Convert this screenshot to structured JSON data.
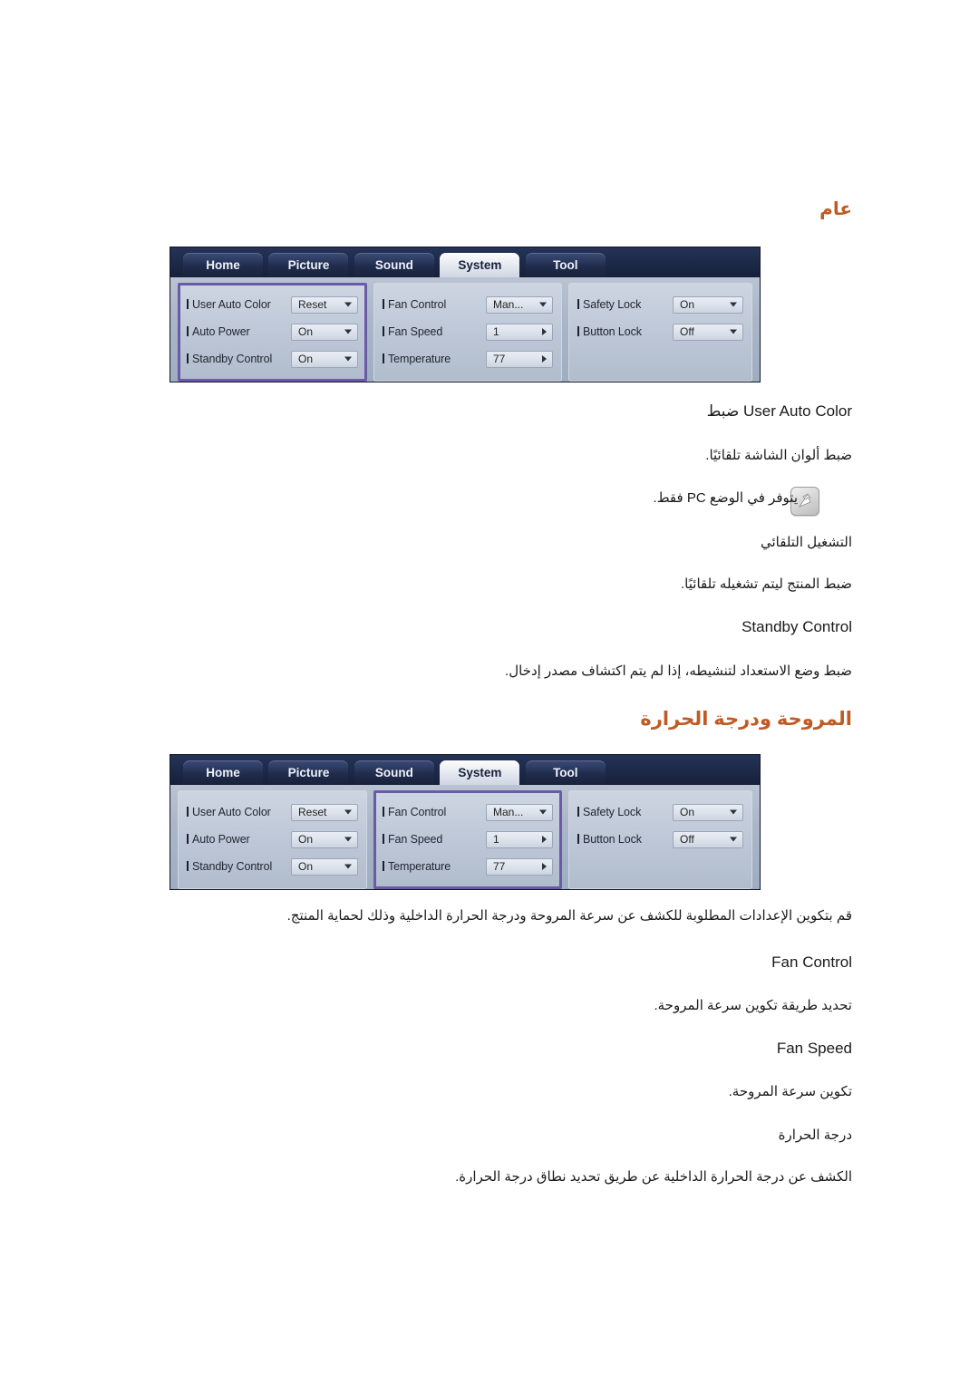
{
  "headings": {
    "general": "عام",
    "fan_temperature": "المروحة ودرجة الحرارة"
  },
  "osd": {
    "tabs": [
      {
        "label": "Home",
        "active": false
      },
      {
        "label": "Picture",
        "active": false
      },
      {
        "label": "Sound",
        "active": false
      },
      {
        "label": "System",
        "active": true
      },
      {
        "label": "Tool",
        "active": false
      }
    ],
    "groups": [
      {
        "name": "general-group",
        "rows": [
          {
            "label": "User Auto Color",
            "value": "Reset",
            "arrow": "down"
          },
          {
            "label": "Auto Power",
            "value": "On",
            "arrow": "down"
          },
          {
            "label": "Standby Control",
            "value": "On",
            "arrow": "down"
          }
        ]
      },
      {
        "name": "fan-group",
        "rows": [
          {
            "label": "Fan Control",
            "value": "Man...",
            "arrow": "down"
          },
          {
            "label": "Fan Speed",
            "value": "1",
            "arrow": "right"
          },
          {
            "label": "Temperature",
            "value": "77",
            "arrow": "right"
          }
        ]
      },
      {
        "name": "lock-group",
        "rows": [
          {
            "label": "Safety Lock",
            "value": "On",
            "arrow": "down"
          },
          {
            "label": "Button Lock",
            "value": "Off",
            "arrow": "down"
          }
        ]
      }
    ],
    "highlight_color": "#6a5ba6",
    "accent_heading_color": "#c05a22"
  },
  "sections": {
    "general": {
      "item1_title": "ضبط User Auto Color",
      "item1_desc": "ضبط ألوان الشاشة تلقائيًا.",
      "note": "يتوفر في الوضع PC فقط.",
      "item2_title": "التشغيل التلقائي",
      "item2_desc": "ضبط المنتج ليتم تشغيله تلقائيًا.",
      "item3_title": "Standby Control",
      "item3_desc": "ضبط وضع الاستعداد لتنشيطه، إذا لم يتم اكتشاف مصدر إدخال."
    },
    "fan": {
      "intro": "قم بتكوين الإعدادات المطلوبة للكشف عن سرعة المروحة ودرجة الحرارة الداخلية وذلك لحماية المنتج.",
      "item1_title": "Fan Control",
      "item1_desc": "تحديد طريقة تكوين سرعة المروحة.",
      "item2_title": "Fan Speed",
      "item2_desc": "تكوين سرعة المروحة.",
      "item3_title": "درجة الحرارة",
      "item3_desc": "الكشف عن درجة الحرارة الداخلية عن طريق تحديد نطاق درجة الحرارة."
    }
  }
}
